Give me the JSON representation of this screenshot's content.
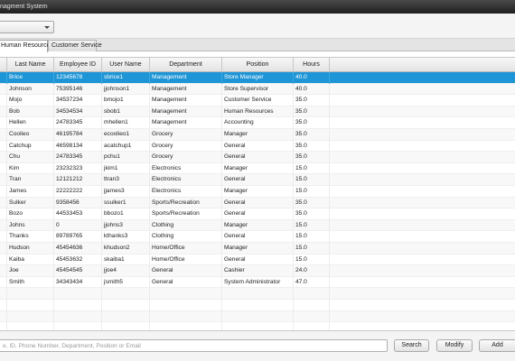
{
  "window": {
    "title": "nagment System"
  },
  "tabs": [
    {
      "label": "Human Resources"
    },
    {
      "label": "Customer Service"
    }
  ],
  "table": {
    "columns": [
      "",
      "Last Name",
      "Employee ID",
      "User Name",
      "Department",
      "Position",
      "Hours"
    ],
    "rows": [
      [
        "",
        "Brice",
        "12345678",
        "sbrice1",
        "Management",
        "Store Manager",
        "40.0"
      ],
      [
        "",
        "Johnson",
        "75395146",
        "jjohnson1",
        "Management",
        "Store Supervisor",
        "40.0"
      ],
      [
        "",
        "Mojo",
        "34537234",
        "bmojo1",
        "Management",
        "Customer Service",
        "35.0"
      ],
      [
        "",
        "Bob",
        "34534534",
        "sbob1",
        "Management",
        "Human Resources",
        "35.0"
      ],
      [
        "",
        "Hellen",
        "24783345",
        "mhellen1",
        "Management",
        "Accounting",
        "35.0"
      ],
      [
        "",
        "Coolieo",
        "46195784",
        "ecoolieo1",
        "Grocery",
        "Manager",
        "35.0"
      ],
      [
        "",
        "Catchup",
        "46598134",
        "acatchup1",
        "Grocery",
        "General",
        "35.0"
      ],
      [
        "",
        "Chu",
        "24783345",
        "pchu1",
        "Grocery",
        "General",
        "35.0"
      ],
      [
        "",
        "Kim",
        "23232323",
        "jkim1",
        "Electronics",
        "Manager",
        "15.0"
      ],
      [
        "",
        "Tran",
        "12121212",
        "ttran3",
        "Electronics",
        "General",
        "15.0"
      ],
      [
        "",
        "James",
        "22222222",
        "jjames3",
        "Electronics",
        "Manager",
        "15.0"
      ],
      [
        "",
        "Sulker",
        "9358456",
        "ssulker1",
        "Sports/Recreation",
        "General",
        "35.0"
      ],
      [
        "",
        "Bozo",
        "44533453",
        "bbozo1",
        "Sports/Recreation",
        "General",
        "35.0"
      ],
      [
        "",
        "Johns",
        "0",
        "jjohns3",
        "Clothing",
        "Manager",
        "15.0"
      ],
      [
        "",
        "Thanks",
        "89789765",
        "kthanks3",
        "Clothing",
        "General",
        "15.0"
      ],
      [
        "",
        "Hudson",
        "45454636",
        "khudson2",
        "Home/Office",
        "Manager",
        "15.0"
      ],
      [
        "",
        "Kaiba",
        "45453632",
        "skaiba1",
        "Home/Office",
        "General",
        "15.0"
      ],
      [
        "",
        "Joe",
        "45454545",
        "jjoe4",
        "General",
        "Cashier",
        "24.0"
      ],
      [
        "",
        "Smith",
        "34343434",
        "jsmith5",
        "General",
        "System Administrator",
        "47.0"
      ]
    ],
    "selected_row": 0
  },
  "search": {
    "placeholder": "e, ID, Phone Number, Department, Position or Email"
  },
  "buttons": {
    "search": "Search",
    "modify": "Modify",
    "add": "Add"
  }
}
